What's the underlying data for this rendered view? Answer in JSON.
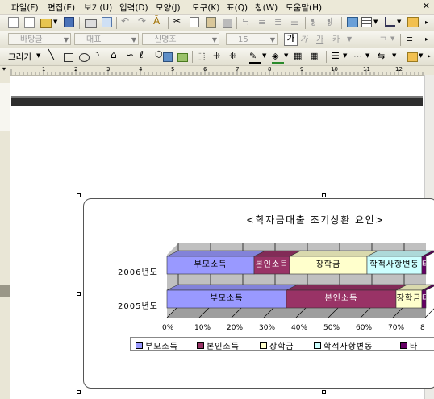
{
  "menu": [
    {
      "label": "파일(F)"
    },
    {
      "label": "편집(E)"
    },
    {
      "label": "보기(U)"
    },
    {
      "label": "입력(D)"
    },
    {
      "label": "모양(J)"
    },
    {
      "label": "도구(K)"
    },
    {
      "label": "표(Q)"
    },
    {
      "label": "창(W)"
    },
    {
      "label": "도움말(H)"
    }
  ],
  "format_bar": {
    "style_combo": "바탕글",
    "font_type_combo": "대표",
    "font_combo": "신명조",
    "size_combo": "15",
    "bold": "가",
    "italic": "가",
    "underline": "가",
    "strike": "카"
  },
  "draw_bar": {
    "draw_label": "그리기"
  },
  "ruler": {
    "numbers": [
      "1",
      "2",
      "3",
      "4",
      "5",
      "6",
      "7",
      "8",
      "9",
      "10",
      "11",
      "12"
    ]
  },
  "chart_data": {
    "type": "bar",
    "orientation": "horizontal",
    "stacked": "percent",
    "title": "<학자금대출 조기상환 요인>",
    "categories": [
      "2006년도",
      "2005년도"
    ],
    "series": [
      {
        "name": "부모소득",
        "values": [
          27,
          37
        ],
        "color": "#9999ff"
      },
      {
        "name": "본인소득",
        "values": [
          11,
          34
        ],
        "color": "#993366"
      },
      {
        "name": "장학금",
        "values": [
          24,
          8
        ],
        "color": "#ffffcc"
      },
      {
        "name": "학적사항변동",
        "values": [
          17,
          0
        ],
        "color": "#ccffff"
      },
      {
        "name": "타",
        "values": [
          21,
          21
        ],
        "color": "#660066"
      }
    ],
    "xlim": [
      0,
      100
    ],
    "xticks": [
      "0%",
      "10%",
      "20%",
      "30%",
      "40%",
      "50%",
      "60%",
      "70%",
      "8"
    ],
    "grid": true,
    "legend_position": "bottom"
  }
}
